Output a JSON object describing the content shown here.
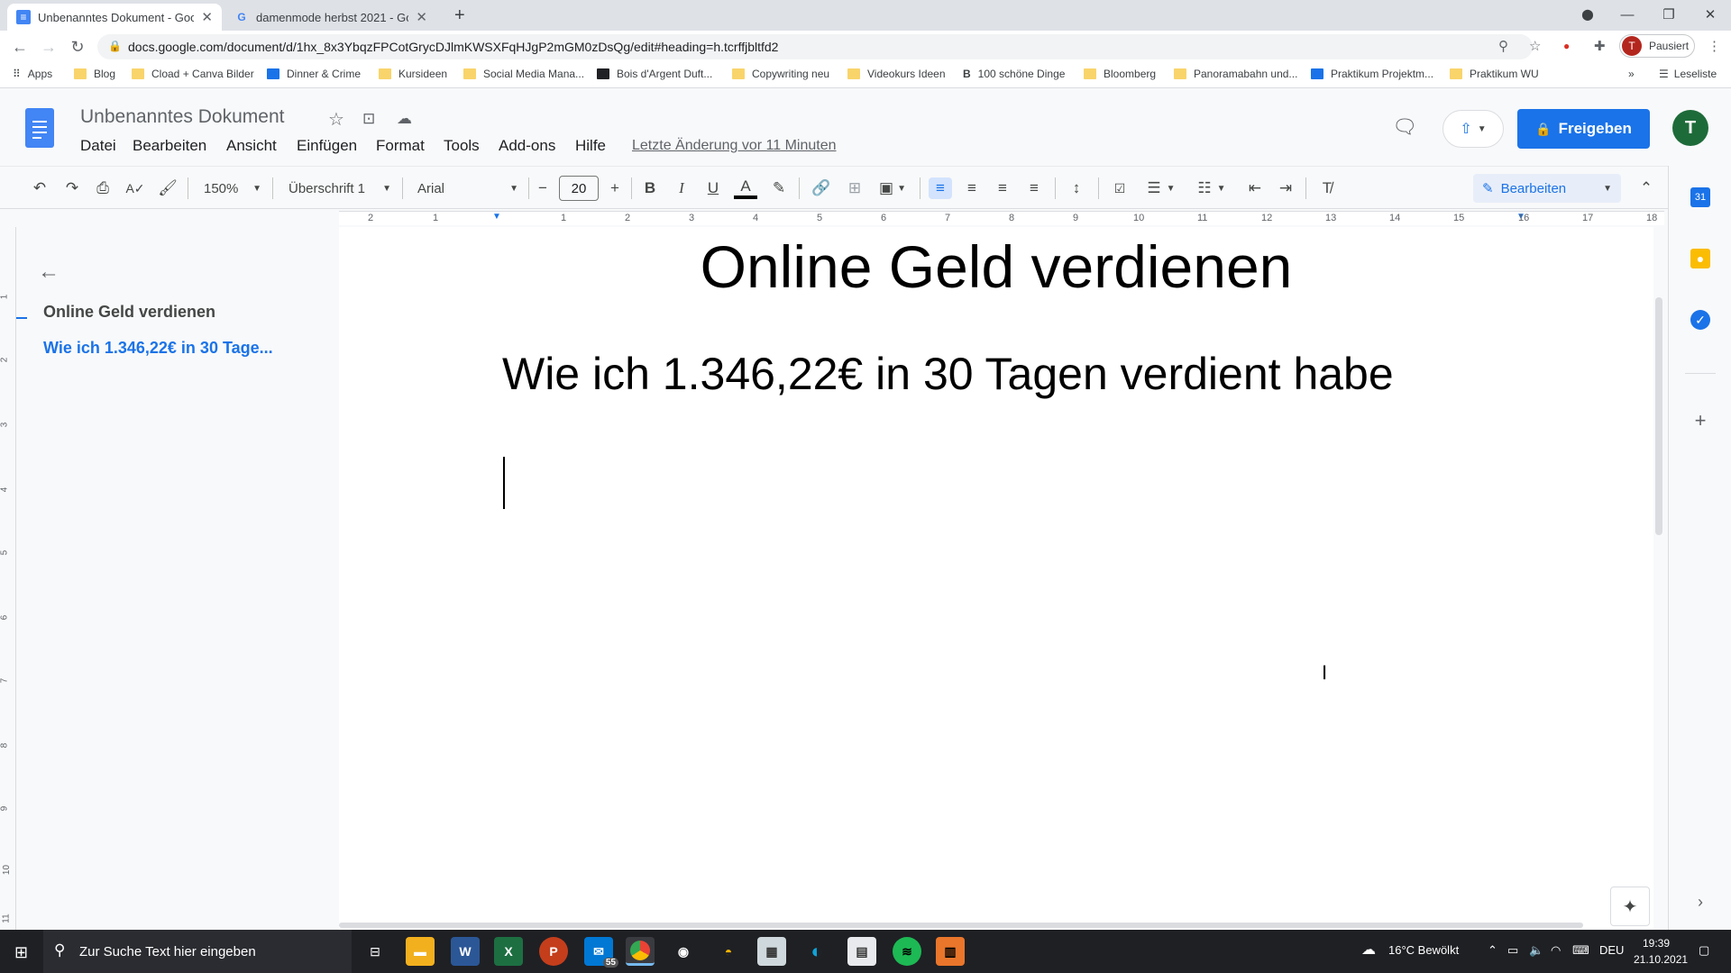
{
  "browser": {
    "tabs": [
      {
        "title": "Unbenanntes Dokument - Goog",
        "active": true
      },
      {
        "title": "damenmode herbst 2021 - Goog",
        "active": false
      }
    ],
    "new_tab": "+",
    "url": "docs.google.com/document/d/1hx_8x3YbqzFPCotGrycDJlmKWSXFqHJgP2mGM0zDsQg/edit#heading=h.tcrffjbltfd2",
    "profile_initial": "T",
    "profile_status": "Pausiert",
    "bookmarks": [
      "Apps",
      "Blog",
      "Cload + Canva Bilder",
      "Dinner & Crime",
      "Kursideen",
      "Social Media Mana...",
      "Bois d'Argent Duft...",
      "Copywriting neu",
      "Videokurs Ideen",
      "100 schöne Dinge",
      "Bloomberg",
      "Panoramabahn und...",
      "Praktikum Projektm...",
      "Praktikum WU"
    ],
    "bookmarks_more": "»",
    "reading_list": "Leseliste"
  },
  "docs": {
    "title": "Unbenanntes Dokument",
    "menus": [
      "Datei",
      "Bearbeiten",
      "Ansicht",
      "Einfügen",
      "Format",
      "Tools",
      "Add-ons",
      "Hilfe"
    ],
    "last_edit": "Letzte Änderung vor 11 Minuten",
    "share_label": "Freigeben",
    "avatar_initial": "T",
    "toolbar": {
      "zoom": "150%",
      "style": "Überschrift 1",
      "font": "Arial",
      "font_size": "20",
      "mode": "Bearbeiten"
    },
    "ruler_numbers": [
      "2",
      "1",
      "1",
      "2",
      "3",
      "4",
      "5",
      "6",
      "7",
      "8",
      "9",
      "10",
      "11",
      "12",
      "13",
      "14",
      "15",
      "16",
      "17",
      "18"
    ],
    "vruler_numbers": [
      "1",
      "2",
      "3",
      "4",
      "5",
      "6",
      "7",
      "8",
      "9",
      "10",
      "11"
    ],
    "outline": {
      "items": [
        "Online Geld verdienen",
        "Wie ich 1.346,22€ in 30 Tage..."
      ]
    },
    "content": {
      "title": "Online Geld verdienen",
      "subtitle": "Wie ich 1.346,22€ in 30 Tagen verdient habe"
    }
  },
  "taskbar": {
    "search_placeholder": "Zur Suche Text hier eingeben",
    "mail_badge": "55",
    "weather": "16°C  Bewölkt",
    "language": "DEU",
    "time": "19:39",
    "date": "21.10.2021"
  },
  "colors": {
    "accent": "#1a73e8",
    "docs_blue": "#4285f4",
    "avatar": "#1e6b3a"
  }
}
